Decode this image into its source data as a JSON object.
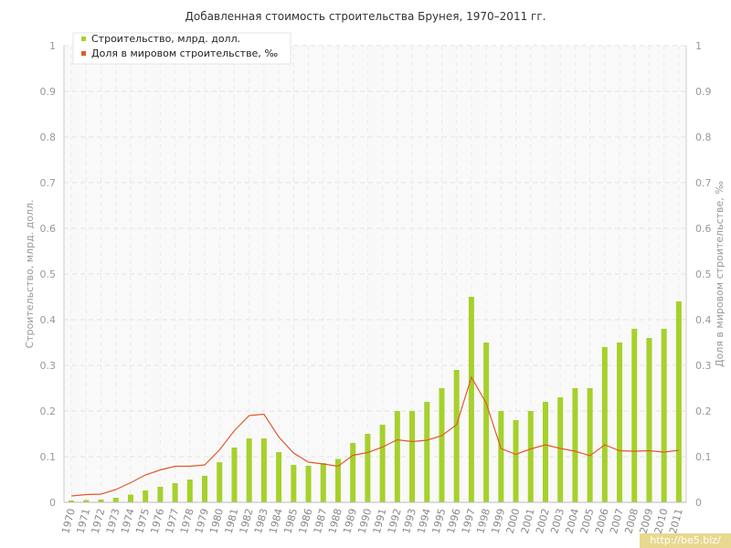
{
  "chart_data": {
    "type": "bar",
    "title": "Добавленная стоимость строительства Брунея, 1970–2011 гг.",
    "ylabel": "Строительство, млрд. долл.",
    "y2label": "Доля в мировом строительстве, ‰",
    "ylim": [
      0,
      1
    ],
    "y2lim": [
      0,
      1
    ],
    "yticks": [
      "0",
      "0.1",
      "0.2",
      "0.3",
      "0.4",
      "0.5",
      "0.6",
      "0.7",
      "0.8",
      "0.9",
      "1"
    ],
    "grid": true,
    "legend_position": "top-left",
    "categories": [
      "1970",
      "1971",
      "1972",
      "1973",
      "1974",
      "1975",
      "1976",
      "1977",
      "1978",
      "1979",
      "1980",
      "1981",
      "1982",
      "1983",
      "1984",
      "1985",
      "1986",
      "1987",
      "1988",
      "1989",
      "1990",
      "1991",
      "1992",
      "1993",
      "1994",
      "1995",
      "1996",
      "1997",
      "1998",
      "1999",
      "2000",
      "2001",
      "2002",
      "2003",
      "2004",
      "2005",
      "2006",
      "2007",
      "2008",
      "2009",
      "2010",
      "2011"
    ],
    "series": [
      {
        "name": "Строительство, млрд. долл.",
        "type": "bar",
        "axis": "left",
        "color": "#a6d12b",
        "values": [
          0.004,
          0.005,
          0.006,
          0.01,
          0.017,
          0.026,
          0.034,
          0.042,
          0.05,
          0.058,
          0.088,
          0.12,
          0.14,
          0.14,
          0.11,
          0.082,
          0.08,
          0.086,
          0.095,
          0.13,
          0.15,
          0.17,
          0.2,
          0.2,
          0.22,
          0.25,
          0.29,
          0.45,
          0.35,
          0.2,
          0.18,
          0.2,
          0.22,
          0.23,
          0.25,
          0.25,
          0.34,
          0.35,
          0.38,
          0.36,
          0.38,
          0.44
        ]
      },
      {
        "name": "Доля в мировом строительстве, ‰",
        "type": "line",
        "axis": "right",
        "color": "#e05a2b",
        "values": [
          0.014,
          0.017,
          0.018,
          0.028,
          0.043,
          0.06,
          0.071,
          0.079,
          0.079,
          0.082,
          0.115,
          0.157,
          0.19,
          0.193,
          0.143,
          0.108,
          0.088,
          0.084,
          0.079,
          0.103,
          0.109,
          0.121,
          0.137,
          0.133,
          0.136,
          0.146,
          0.17,
          0.274,
          0.217,
          0.118,
          0.105,
          0.117,
          0.126,
          0.118,
          0.112,
          0.102,
          0.126,
          0.113,
          0.112,
          0.113,
          0.11,
          0.114
        ]
      }
    ]
  },
  "watermark": "http://be5.biz/"
}
